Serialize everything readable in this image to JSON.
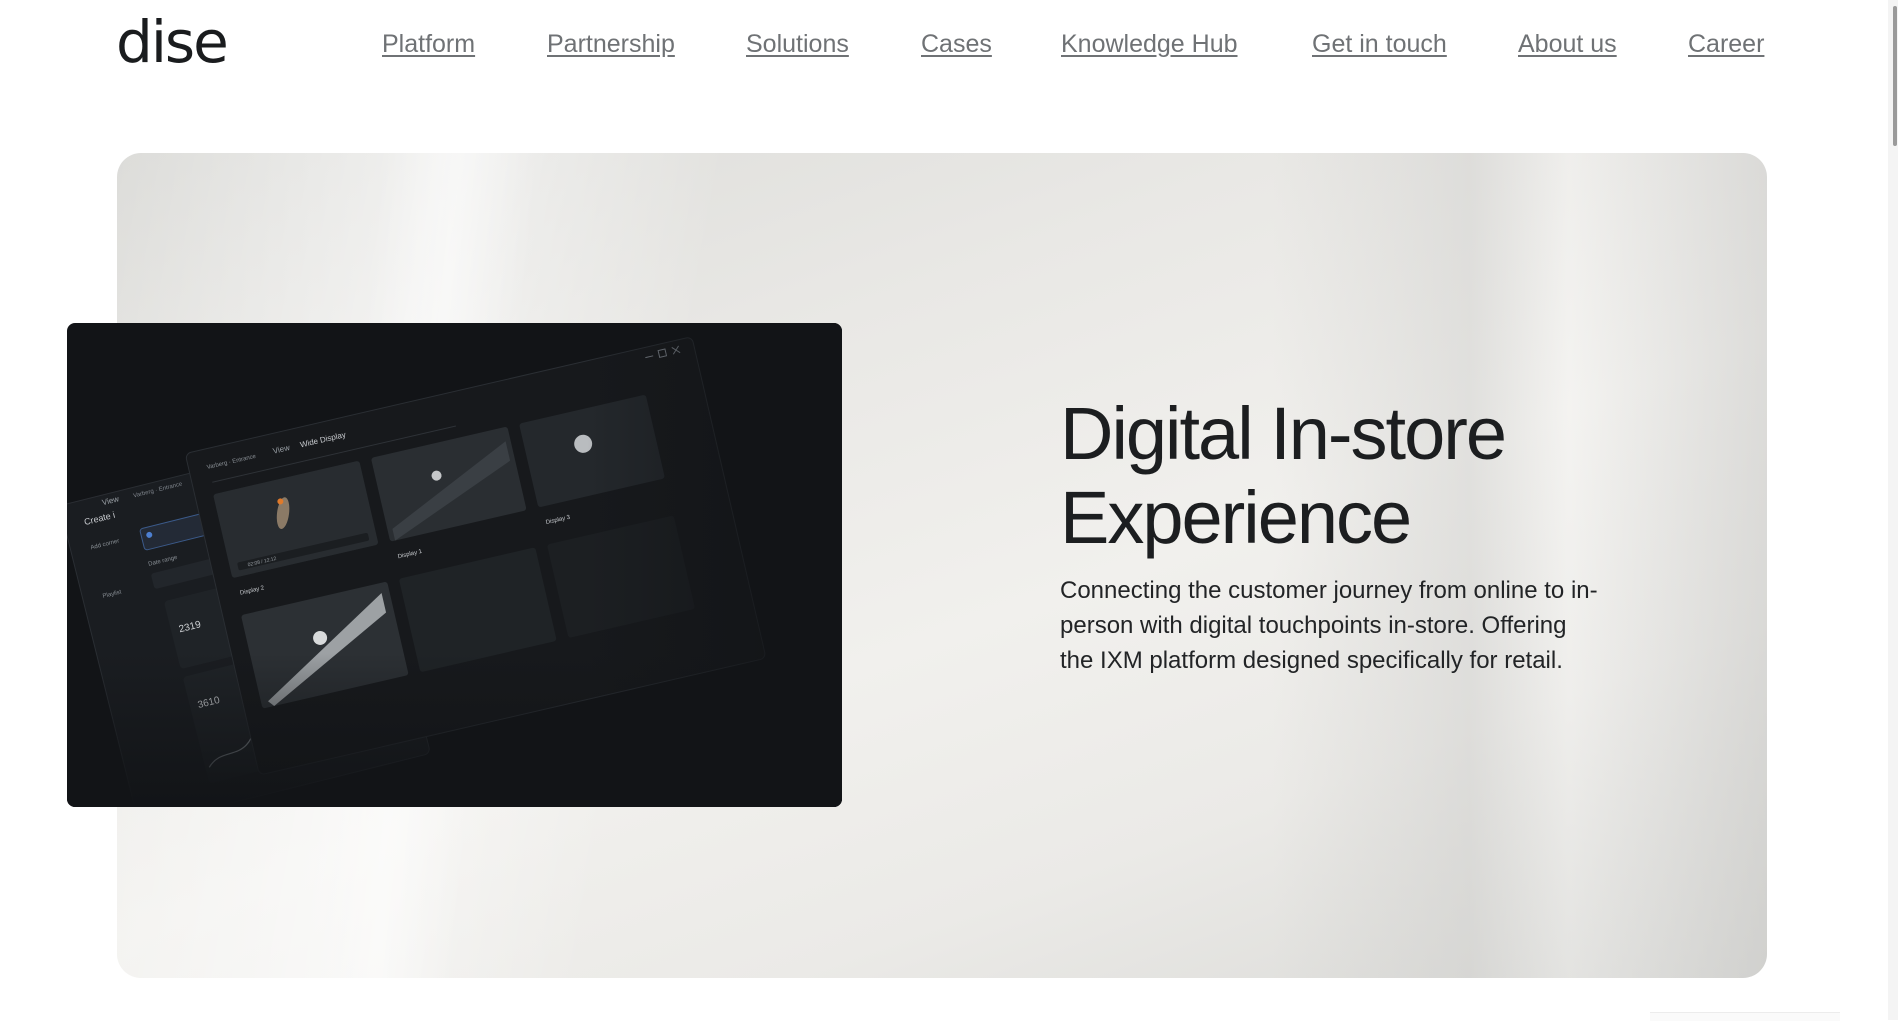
{
  "header": {
    "logo_text": "dise",
    "nav": [
      {
        "label": "Platform"
      },
      {
        "label": "Partnership"
      },
      {
        "label": "Solutions"
      },
      {
        "label": "Cases"
      },
      {
        "label": "Knowledge Hub"
      },
      {
        "label": "Get in touch"
      },
      {
        "label": "About us"
      },
      {
        "label": "Career"
      }
    ]
  },
  "hero": {
    "title_line1": "Digital In-store",
    "title_line2": "Experience",
    "description": "Connecting the customer journey from online to in-person with digital touchpoints in-store. Offering the IXM platform designed specifically for retail.",
    "preview": {
      "tab_location": "Varberg · Entrance",
      "tab_view": "View",
      "tab_wide": "Wide Display",
      "back_tab_view": "View",
      "back_tab_location": "Varberg · Entrance",
      "create_label": "Create i",
      "player_time": "02:08 / 12:12",
      "display_2": "Display 2",
      "display_1": "Display 1",
      "display_3": "Display 3",
      "metric_a": "2319",
      "metric_b": "3610",
      "section_playlist": "Playlist",
      "section_date": "Date range",
      "add_corner": "Add corner"
    }
  },
  "colors": {
    "text_dark": "#1c1e20",
    "nav_text": "#6f7275",
    "preview_bg": "#121417"
  }
}
